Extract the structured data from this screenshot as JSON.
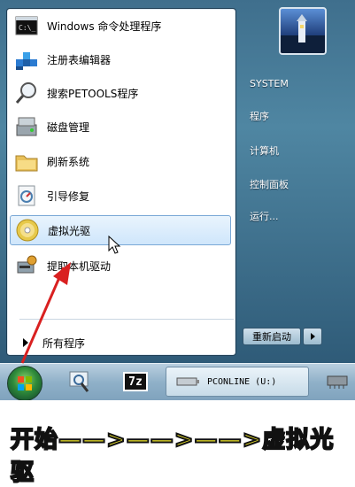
{
  "start_menu": {
    "programs": [
      {
        "label": "Windows 命令处理程序",
        "icon": "cmd-icon"
      },
      {
        "label": "注册表编辑器",
        "icon": "regedit-icon"
      },
      {
        "label": "搜索PETOOLS程序",
        "icon": "search-icon"
      },
      {
        "label": "磁盘管理",
        "icon": "disk-management-icon"
      },
      {
        "label": "刷新系统",
        "icon": "folder-icon"
      },
      {
        "label": "引导修复",
        "icon": "boot-repair-icon"
      },
      {
        "label": "虚拟光驱",
        "icon": "cd-icon"
      },
      {
        "label": "提取本机驱动",
        "icon": "driver-icon"
      }
    ],
    "all_programs_label": "所有程序",
    "right_pane": {
      "username": "SYSTEM",
      "items": [
        "程序",
        "计算机",
        "控制面板",
        "运行..."
      ]
    },
    "power": {
      "restart_label": "重新启动"
    }
  },
  "taskbar": {
    "pconline_label": "PCONLINE (U:)",
    "sevenzip_label": "7z"
  },
  "caption": {
    "text": "开始——>——>——>虚拟光驱"
  },
  "colors": {
    "menu_blue": "#3f6f8d",
    "highlight": "#cfe6fb",
    "annotation_red": "#d92020",
    "caption_yellow": "#f1e82b"
  }
}
